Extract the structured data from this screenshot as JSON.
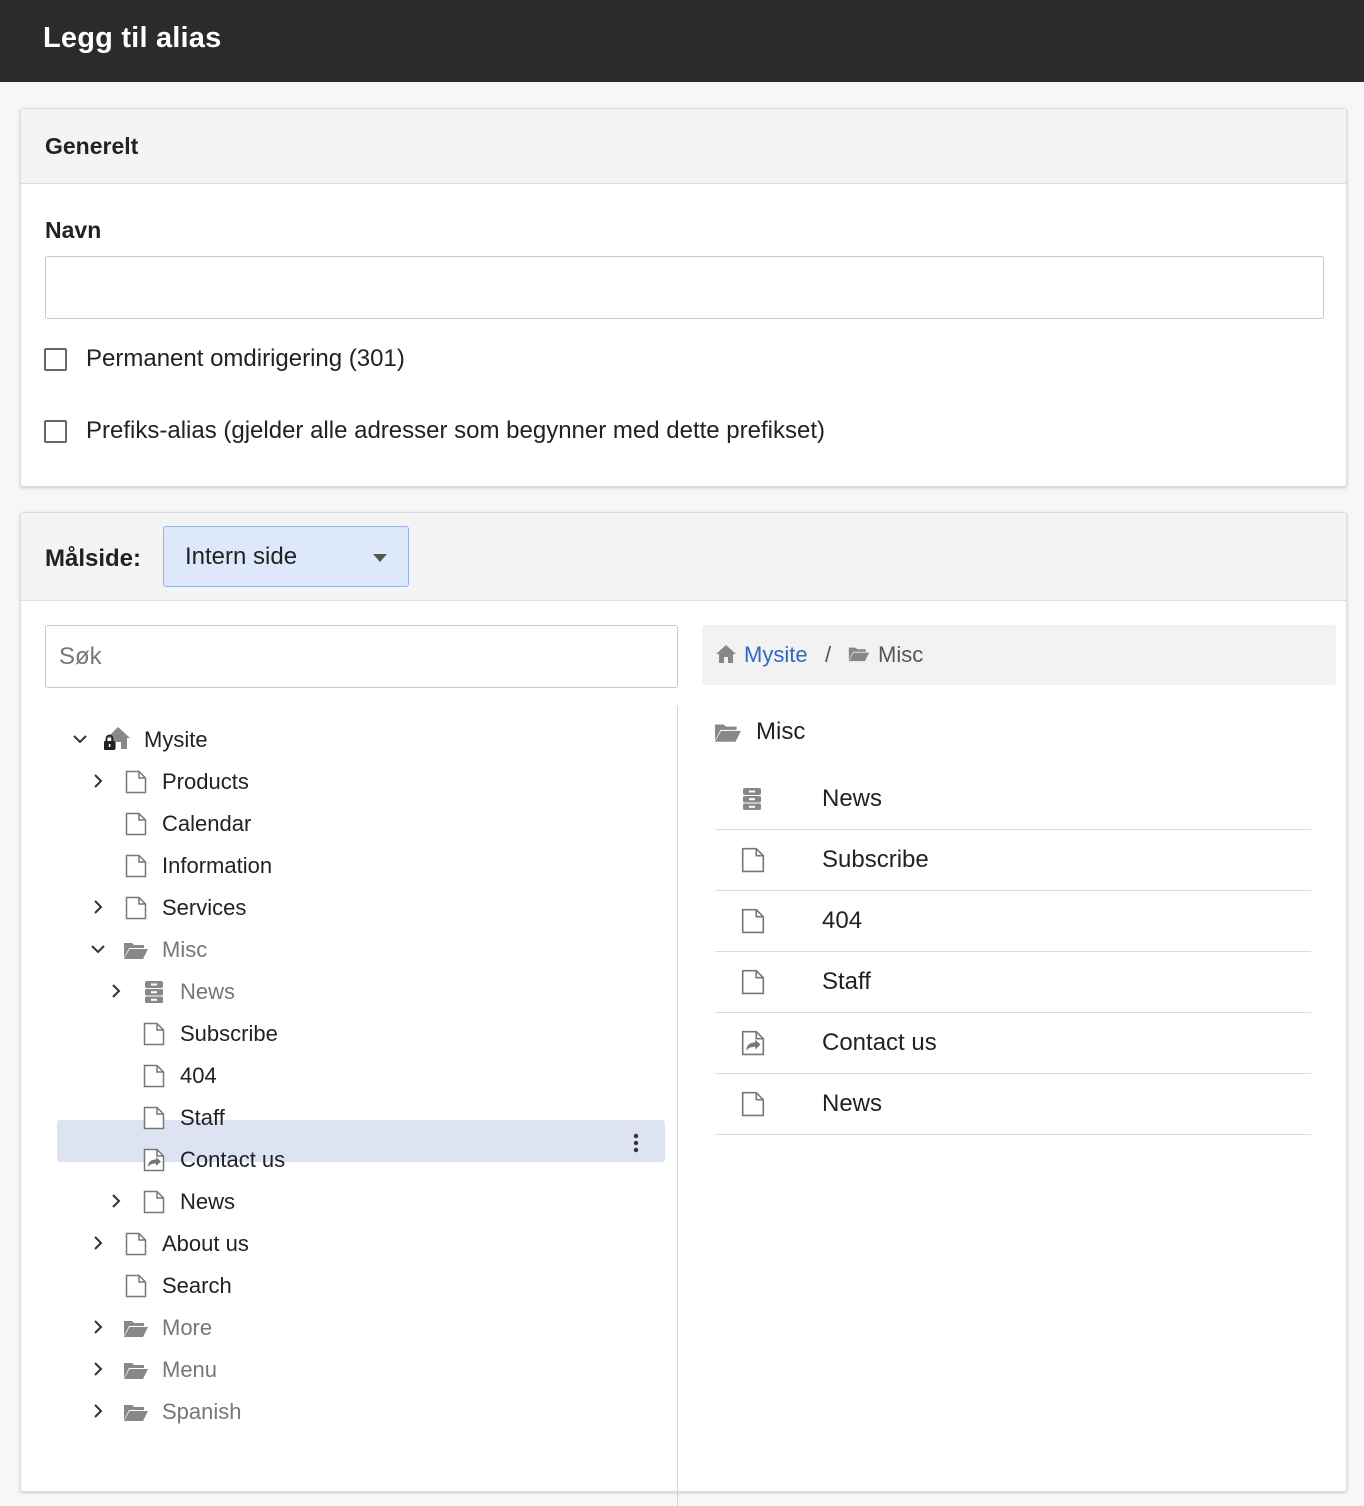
{
  "header": {
    "title": "Legg til alias"
  },
  "general": {
    "title": "Generelt",
    "name_label": "Navn",
    "name_value": "",
    "checkbox_permanent": "Permanent omdirigering (301)",
    "checkbox_prefix": "Prefiks-alias (gjelder alle adresser som begynner med dette prefikset)"
  },
  "target": {
    "label": "Målside:",
    "select_value": "Intern side",
    "search_placeholder": "Søk",
    "breadcrumb": {
      "root": "Mysite",
      "separator": "/",
      "current": "Misc"
    }
  },
  "tree": {
    "root": "Mysite",
    "items": [
      {
        "label": "Products"
      },
      {
        "label": "Calendar"
      },
      {
        "label": "Information"
      },
      {
        "label": "Services"
      },
      {
        "label": "Misc"
      },
      {
        "label": "News"
      },
      {
        "label": "Subscribe"
      },
      {
        "label": "404"
      },
      {
        "label": "Staff"
      },
      {
        "label": "Contact us"
      },
      {
        "label": "News"
      },
      {
        "label": "About us"
      },
      {
        "label": "Search"
      },
      {
        "label": "More"
      },
      {
        "label": "Menu"
      },
      {
        "label": "Spanish"
      }
    ]
  },
  "folder_view": {
    "title": "Misc",
    "items": [
      {
        "label": "News",
        "icon": "archive-icon"
      },
      {
        "label": "Subscribe",
        "icon": "page-icon"
      },
      {
        "label": "404",
        "icon": "page-icon"
      },
      {
        "label": "Staff",
        "icon": "page-icon"
      },
      {
        "label": "Contact us",
        "icon": "redirect-page-icon"
      },
      {
        "label": "News",
        "icon": "page-icon"
      }
    ]
  }
}
